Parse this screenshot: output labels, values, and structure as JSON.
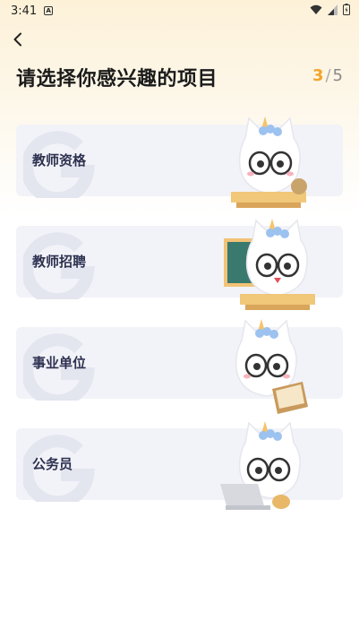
{
  "status_bar": {
    "time": "3:41",
    "notif_icon": "a-icon"
  },
  "header": {
    "back_icon": "chevron-left-icon"
  },
  "page": {
    "title": "请选择你感兴趣的项目"
  },
  "step": {
    "current": "3",
    "separator": "/",
    "total": "5"
  },
  "options": [
    {
      "label": "教师资格"
    },
    {
      "label": "教师招聘"
    },
    {
      "label": "事业单位"
    },
    {
      "label": "公务员"
    }
  ],
  "colors": {
    "accent": "#f4a42c",
    "card_bg": "#f2f3f8",
    "card_text": "#2d3150"
  }
}
